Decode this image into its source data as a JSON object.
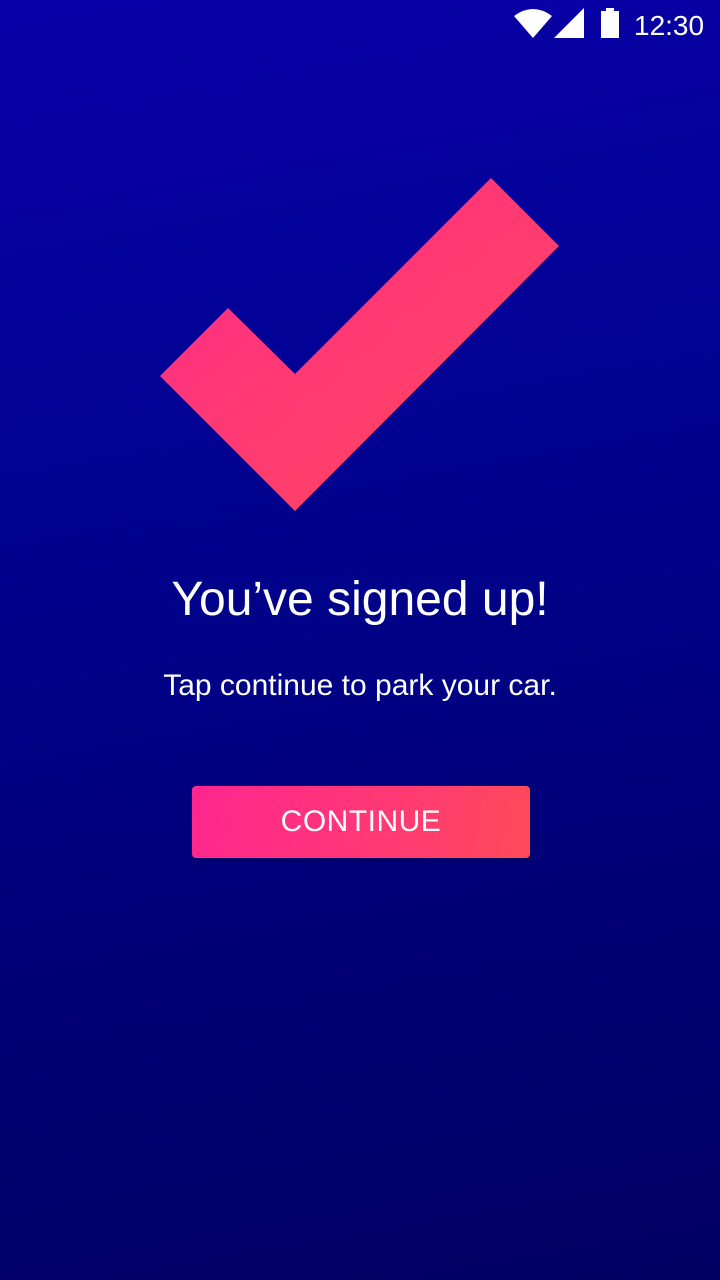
{
  "status_bar": {
    "time": "12:30",
    "icons": [
      "wifi-icon",
      "cell-signal-icon",
      "battery-icon"
    ]
  },
  "illustration": {
    "icon": "checkmark-icon",
    "gradient_start": "#ff2a8a",
    "gradient_end": "#ff4a5a"
  },
  "main": {
    "title": "You’ve signed up!",
    "subtitle": "Tap continue to park your car.",
    "continue_label": "CONTINUE"
  },
  "colors": {
    "background_top": "#0a00a8",
    "background_bottom": "#000062",
    "accent": "#ff2a8a"
  }
}
